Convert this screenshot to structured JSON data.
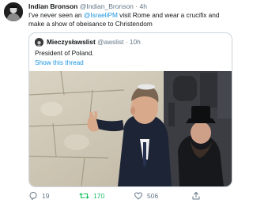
{
  "tweet": {
    "author_name": "Indian Bronson",
    "author_handle": "@Indian_Bronson",
    "time": "4h",
    "text_before": "I've never seen an ",
    "mention": "@IsraeliPM",
    "text_after": " visit Rome and wear a crucifix and make a show of obeisance to Christendom"
  },
  "quoted": {
    "author_name": "Mieczysławslist",
    "author_handle": "@awslist",
    "time": "10h",
    "text": "President of Poland.",
    "thread_link": "Show this thread"
  },
  "actions": {
    "replies": "19",
    "retweets": "170",
    "likes": "506"
  },
  "colors": {
    "link": "#1b95e0",
    "retweet_active": "#17bf63",
    "meta": "#657786",
    "border": "#ccd6dd"
  },
  "icons": [
    "reply-icon",
    "retweet-icon",
    "like-icon",
    "share-icon"
  ]
}
